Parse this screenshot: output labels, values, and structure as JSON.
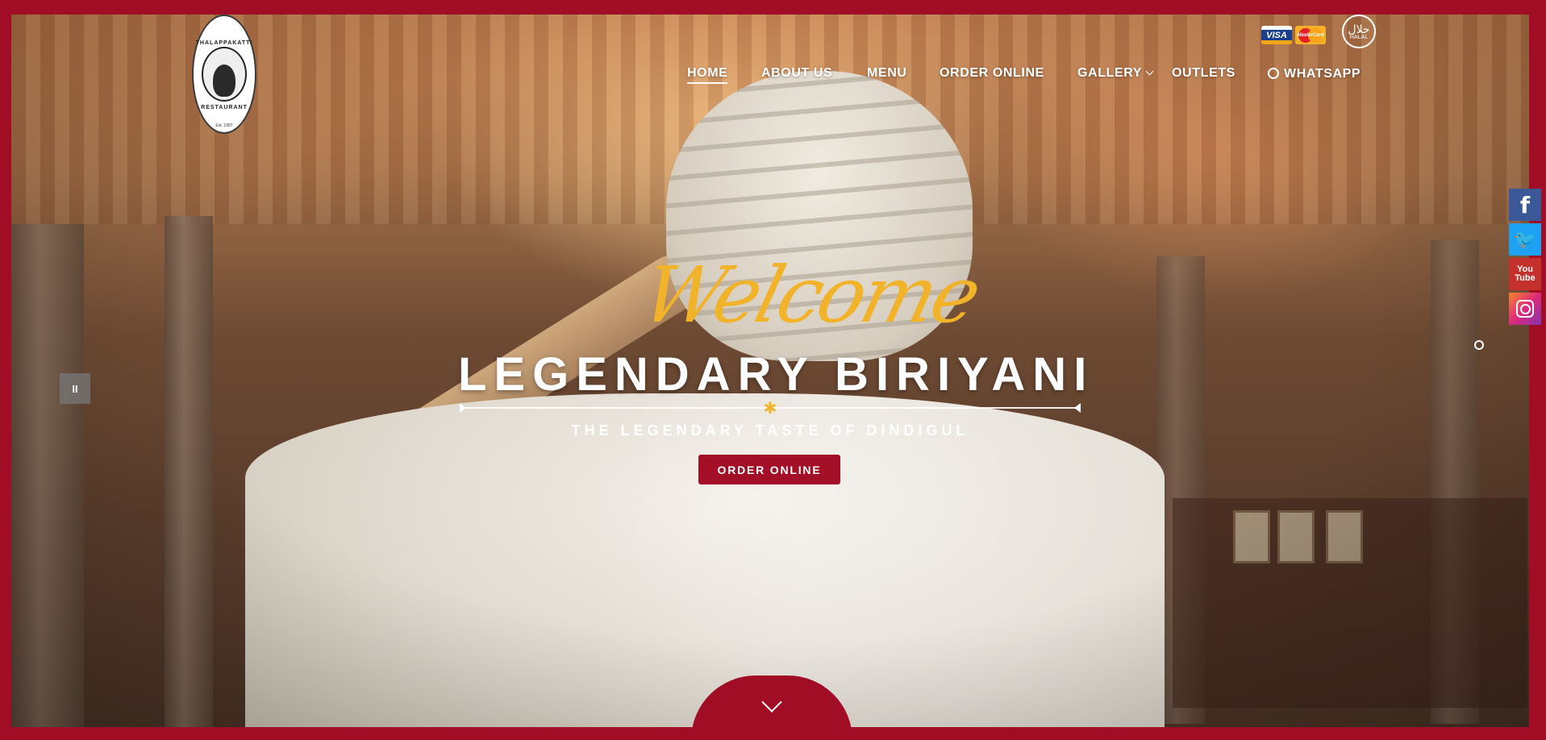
{
  "brand": {
    "logo_top": "THALAPPAKATTI",
    "logo_bottom": "RESTAURANT",
    "logo_est": "Est. 1957",
    "accent_color": "#a00d25",
    "gold_color": "#f1b32a"
  },
  "payment": {
    "visa": "VISA",
    "mastercard": "MasterCard",
    "halal": "HALAL",
    "halal_arabic": "حلال"
  },
  "nav": {
    "home": "HOME",
    "about": "ABOUT US",
    "menu": "MENU",
    "order": "ORDER ONLINE",
    "gallery": "GALLERY",
    "outlets": "OUTLETS",
    "whatsapp": "WHATSAPP"
  },
  "social": {
    "facebook": "f",
    "twitter": "🐦",
    "youtube_1": "You",
    "youtube_2": "Tube"
  },
  "hero": {
    "welcome": "Welcome",
    "headline": "LEGENDARY BIRIYANI",
    "star": "✱",
    "tagline": "THE LEGENDARY TASTE OF DINDIGUL",
    "button": "ORDER ONLINE",
    "pause_icon": "II"
  }
}
